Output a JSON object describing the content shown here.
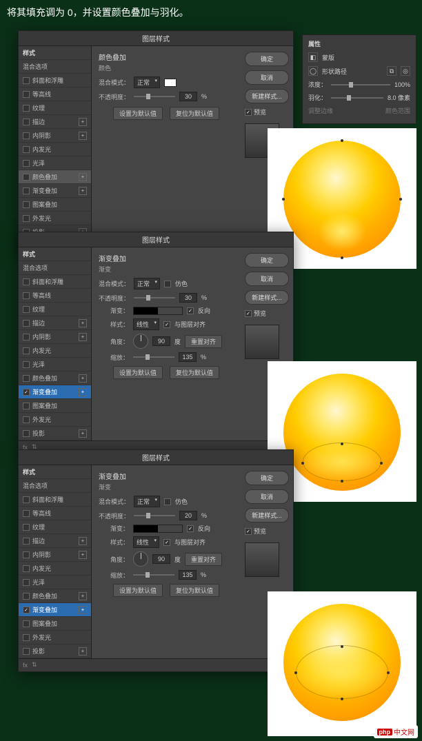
{
  "instruction": "将其填充调为 0，并设置颜色叠加与羽化。",
  "dialog_title": "图层样式",
  "styles": {
    "header": "样式",
    "blend_options": "混合选项",
    "items": [
      {
        "label": "斜面和浮雕"
      },
      {
        "label": "等高线"
      },
      {
        "label": "纹理"
      },
      {
        "label": "描边",
        "plus": true
      },
      {
        "label": "内阴影",
        "plus": true
      },
      {
        "label": "内发光"
      },
      {
        "label": "光泽"
      },
      {
        "label": "颜色叠加",
        "plus": true
      },
      {
        "label": "渐变叠加",
        "plus": true
      },
      {
        "label": "图案叠加"
      },
      {
        "label": "外发光"
      },
      {
        "label": "投影",
        "plus": true
      }
    ]
  },
  "buttons": {
    "ok": "确定",
    "cancel": "取消",
    "new_style": "新建样式...",
    "preview": "预览",
    "set_default": "设置为默认值",
    "reset_default": "复位为默认值"
  },
  "panel1": {
    "section": "颜色叠加",
    "sub": "颜色",
    "blend_label": "混合模式：",
    "blend_value": "正常",
    "opacity_label": "不透明度：",
    "opacity": "30",
    "pct": "%"
  },
  "panel2": {
    "section": "渐变叠加",
    "sub": "渐变",
    "blend_label": "混合模式：",
    "blend_value": "正常",
    "dither": "仿色",
    "opacity_label": "不透明度：",
    "opacity": "30",
    "pct": "%",
    "gradient_label": "渐变：",
    "reverse": "反向",
    "style_label": "样式：",
    "style_value": "线性",
    "align": "与图层对齐",
    "angle_label": "角度：",
    "angle": "90",
    "deg": "度",
    "reset_align": "重置对齐",
    "scale_label": "缩放：",
    "scale": "135"
  },
  "panel3": {
    "section": "渐变叠加",
    "sub": "渐变",
    "blend_label": "混合模式：",
    "blend_value": "正常",
    "dither": "仿色",
    "opacity_label": "不透明度：",
    "opacity": "20",
    "pct": "%",
    "gradient_label": "渐变：",
    "reverse": "反向",
    "style_label": "样式：",
    "style_value": "线性",
    "align": "与图层对齐",
    "angle_label": "角度：",
    "angle": "90",
    "deg": "度",
    "reset_align": "重置对齐",
    "scale_label": "缩放：",
    "scale": "135"
  },
  "props": {
    "title": "属性",
    "mask": "蒙版",
    "shape_path": "形状路径",
    "density_label": "浓度：",
    "density": "100%",
    "feather_label": "羽化：",
    "feather": "8.0 像素",
    "refine": "调整边缘",
    "color_range": "颜色范围"
  },
  "watermark": {
    "brand": "php",
    "text": "中文网"
  },
  "footer": "fx"
}
